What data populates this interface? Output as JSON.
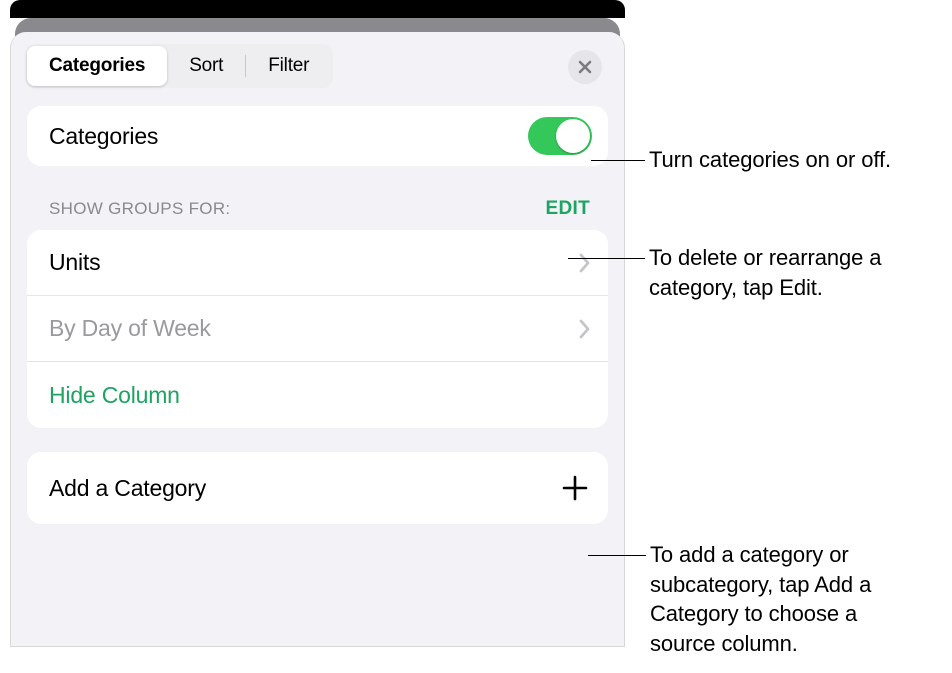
{
  "tabs": {
    "categories": "Categories",
    "sort": "Sort",
    "filter": "Filter"
  },
  "toggle": {
    "label": "Categories",
    "on": true
  },
  "section": {
    "title": "Show Groups For:",
    "edit": "EDIT"
  },
  "groups": {
    "item1": "Units",
    "item2_prefix": "By ",
    "item2_value": "Day of Week",
    "hide": "Hide Column"
  },
  "add": {
    "label": "Add a Category"
  },
  "callouts": {
    "c1": "Turn categories on or off.",
    "c2": "To delete or rearrange a category, tap Edit.",
    "c3": "To add a category or subcategory, tap Add a Category to choose a source column."
  }
}
